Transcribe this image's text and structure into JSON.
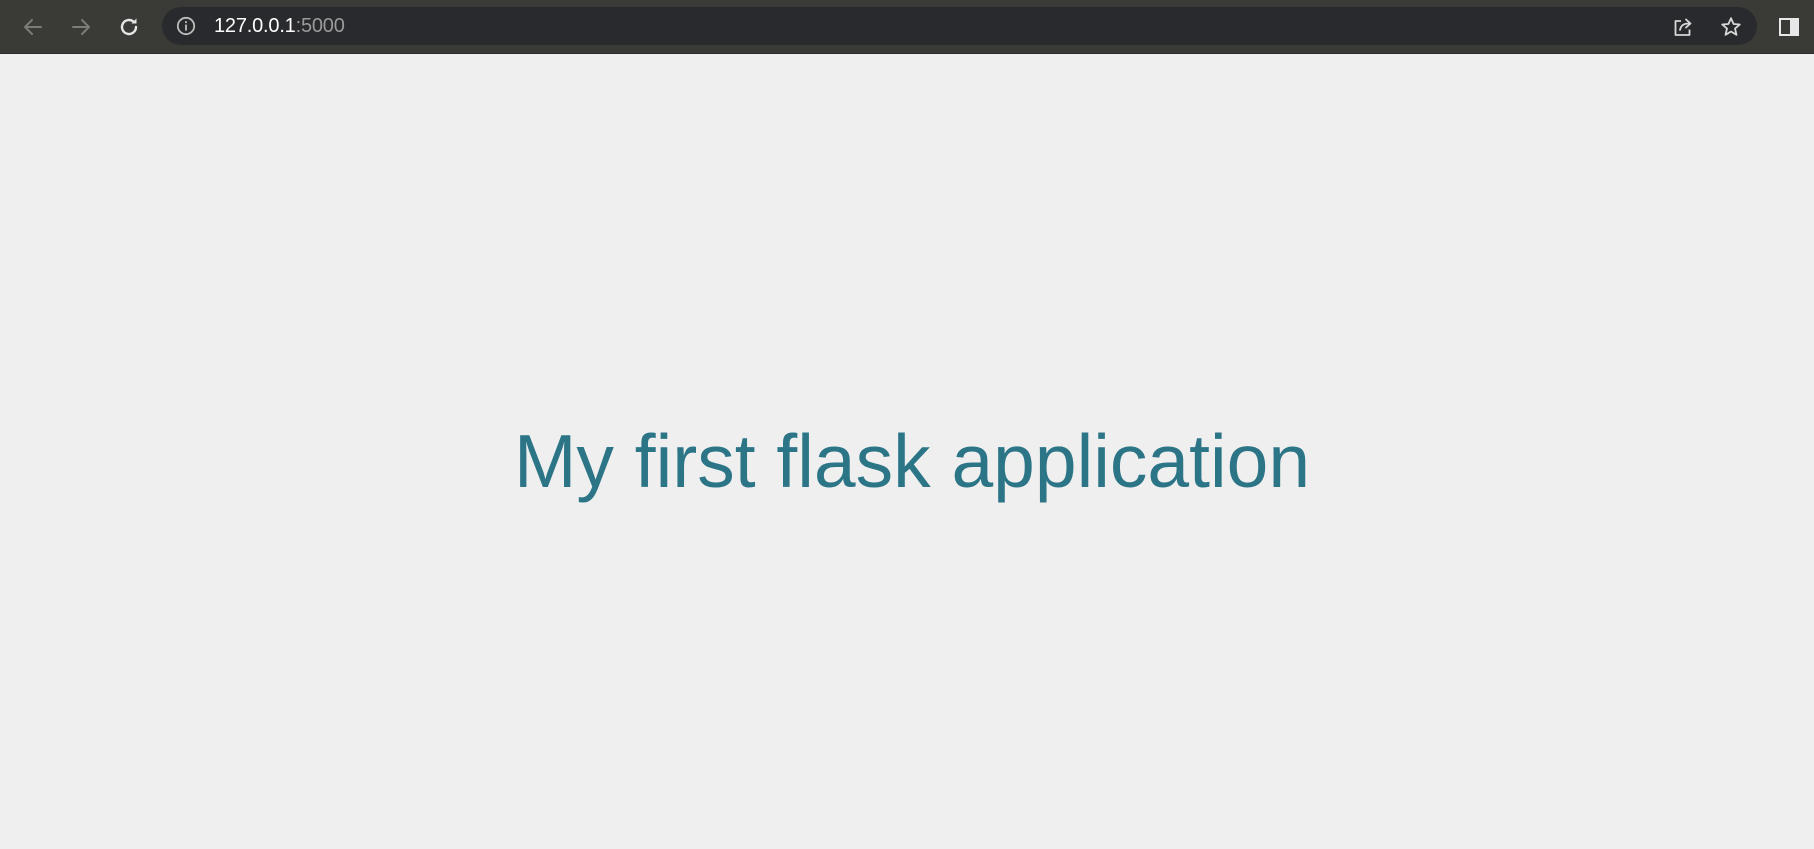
{
  "browser": {
    "address_bar": {
      "host": "127.0.0.1",
      "port": ":5000"
    },
    "icons": {
      "back": "arrow-left-icon",
      "forward": "arrow-right-icon",
      "reload": "reload-icon",
      "site_info": "info-icon",
      "share": "share-icon",
      "bookmark": "star-icon",
      "side_panel": "side-panel-icon"
    },
    "colors": {
      "toolbar": "#3a3a37",
      "omnibox": "#292a2d"
    }
  },
  "page": {
    "heading": "My first flask application",
    "heading_color": "#2b7587",
    "background": "#efefef"
  }
}
